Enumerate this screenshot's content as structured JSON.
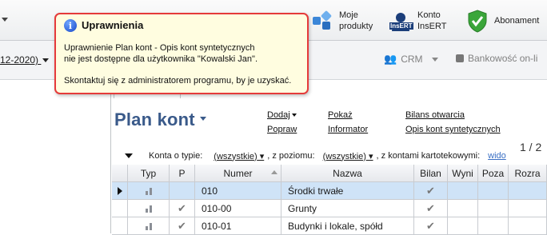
{
  "toolbar": {
    "moje_produkty": [
      "Moje",
      "produkty"
    ],
    "konto": [
      "Konto",
      "InsERT"
    ],
    "konto_icon_text": "InsERT",
    "abonament": "Abonament"
  },
  "navbar": {
    "date_fragment": "12-2020)",
    "crm": "CRM",
    "bank": "Bankowość on-li"
  },
  "tab": {
    "label": "Plan kont"
  },
  "page": {
    "title": "Plan kont",
    "page_indicator": "1 / 2"
  },
  "actions": {
    "dodaj": "Dodaj",
    "pokaz": "Pokaż",
    "bilans": "Bilans otwarcia",
    "popraw": "Popraw",
    "informator": "Informator",
    "opis": "Opis kont syntetycznych"
  },
  "filter": {
    "label_type": "Konta o typie:",
    "type_value": "(wszystkie)",
    "label_level": ", z poziomu:",
    "level_value": "(wszystkie)",
    "label_cards": ", z kontami kartotekowymi:",
    "cards_value": "wido"
  },
  "grid": {
    "columns": [
      "Typ",
      "P",
      "Numer",
      "Nazwa",
      "Bilan",
      "Wyni",
      "Poza",
      "Rozra"
    ],
    "rows": [
      {
        "p": "",
        "numer": "010",
        "nazwa": "Środki trwałe",
        "bilan": "✔",
        "selected": true
      },
      {
        "p": "✔",
        "numer": "010-00",
        "nazwa": "Grunty",
        "bilan": "✔",
        "selected": false
      },
      {
        "p": "✔",
        "numer": "010-01",
        "nazwa": "Budynki i lokale, spółd",
        "bilan": "✔",
        "selected": false
      }
    ]
  },
  "tooltip": {
    "title": "Uprawnienia",
    "lines": [
      "Uprawnienie Plan kont - Opis kont syntetycznych",
      "nie jest dostępne dla użytkownika \"Kowalski Jan\".",
      "Skontaktuj się z administratorem programu, by je uzyskać."
    ],
    "border_color": "#e53a3a",
    "background": "#fffde0"
  }
}
